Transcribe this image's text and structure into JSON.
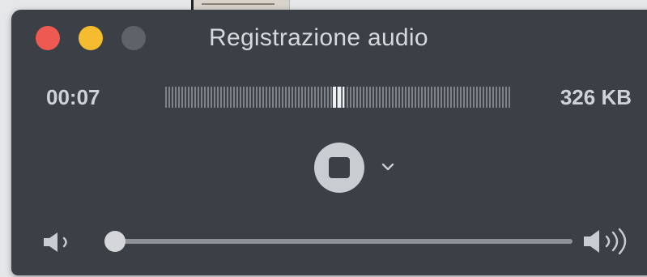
{
  "window": {
    "title": "Registrazione audio"
  },
  "recording": {
    "elapsed_time": "00:07",
    "file_size": "326 KB",
    "level_fraction": 0.5
  },
  "controls": {
    "stop_icon": "stop-icon",
    "options_icon": "chevron-down-icon"
  },
  "volume": {
    "low_icon": "speaker-low-icon",
    "high_icon": "speaker-high-icon",
    "level_fraction": 0.0
  },
  "colors": {
    "close": "#ee5a52",
    "minimize": "#f5bc2f",
    "maximize_disabled": "#5f6369",
    "window_bg": "#3b4046"
  }
}
